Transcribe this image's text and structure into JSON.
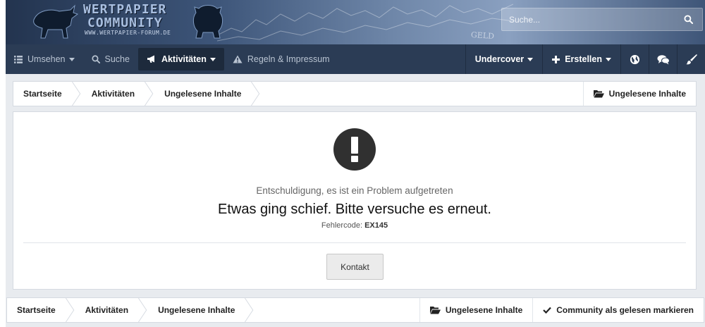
{
  "header": {
    "logo_title_line1": "WERTPAPIER",
    "logo_title_line2": "COMMUNITY",
    "logo_subtitle": "WWW.WERTPAPIER-FORUM.DE",
    "banner_word": "GELD",
    "search": {
      "placeholder": "Suche..."
    }
  },
  "nav": {
    "left": [
      {
        "label": "Umsehen",
        "icon": "list-icon",
        "dropdown": true
      },
      {
        "label": "Suche",
        "icon": "search-icon"
      },
      {
        "label": "Aktivitäten",
        "icon": "megaphone-icon",
        "dropdown": true,
        "active": true
      },
      {
        "label": "Regeln & Impressum",
        "icon": "warning-icon"
      }
    ],
    "right": [
      {
        "label": "Undercover",
        "dropdown": true
      },
      {
        "label": "Erstellen",
        "icon": "plus-icon",
        "dropdown": true
      },
      {
        "icon": "globe-icon"
      },
      {
        "icon": "chat-icon"
      },
      {
        "icon": "brush-icon"
      }
    ]
  },
  "breadcrumb_top": {
    "items": [
      "Startseite",
      "Aktivitäten",
      "Ungelesene Inhalte"
    ],
    "action": "Ungelesene Inhalte"
  },
  "error": {
    "subtitle": "Entschuldigung, es ist ein Problem aufgetreten",
    "title": "Etwas ging schief. Bitte versuche es erneut.",
    "code_label": "Fehlercode:",
    "code": "EX145",
    "contact_label": "Kontakt"
  },
  "breadcrumb_bottom": {
    "items": [
      "Startseite",
      "Aktivitäten",
      "Ungelesene Inhalte"
    ],
    "action_unread": "Ungelesene Inhalte",
    "action_mark_read": "Community als gelesen markieren"
  },
  "colors": {
    "nav_bg": "#2b3c55",
    "nav_active_bg": "#1d2a3c",
    "page_bg": "#e8ebef"
  }
}
